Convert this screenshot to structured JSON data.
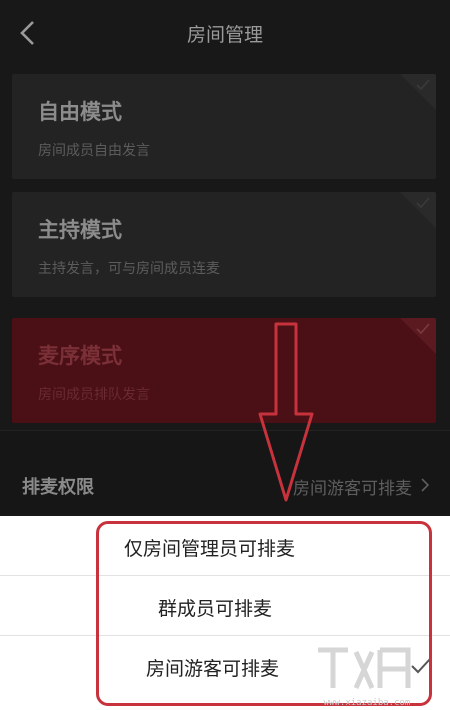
{
  "header": {
    "title": "房间管理"
  },
  "modes": [
    {
      "title": "自由模式",
      "desc": "房间成员自由发言",
      "selected": false
    },
    {
      "title": "主持模式",
      "desc": "主持发言，可与房间成员连麦",
      "selected": false
    },
    {
      "title": "麦序模式",
      "desc": "房间成员排队发言",
      "selected": true
    }
  ],
  "permission": {
    "label": "排麦权限",
    "value": "房间游客可排麦"
  },
  "sheet": {
    "options": [
      {
        "label": "仅房间管理员可排麦",
        "checked": false
      },
      {
        "label": "群成员可排麦",
        "checked": false
      },
      {
        "label": "房间游客可排麦",
        "checked": true
      }
    ]
  },
  "watermark": {
    "text": "www.xiazaiba.com"
  },
  "colors": {
    "annotation": "#c8323c",
    "selected_mode_bg": "#4a1016",
    "sheet_bg": "#ffffff"
  },
  "icons": {
    "back": "chevron-left-icon",
    "chevron": "chevron-right-icon",
    "check": "checkmark-icon",
    "arrow": "down-arrow-icon"
  }
}
